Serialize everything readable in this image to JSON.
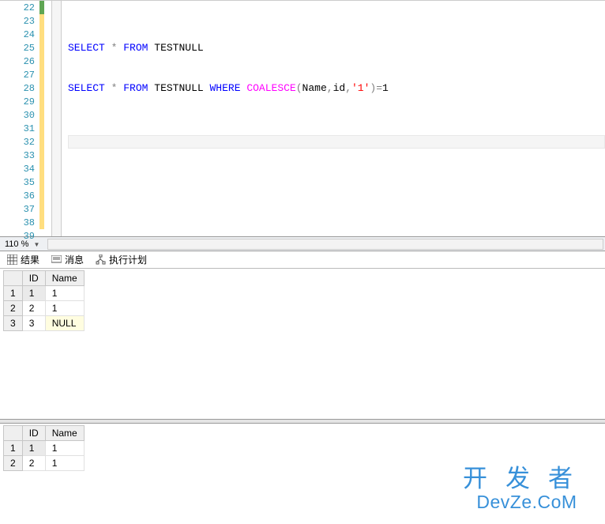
{
  "editor": {
    "line_start": 22,
    "line_end": 39,
    "marked_green": [
      22
    ],
    "marked_yellow": [
      23,
      24,
      25,
      26,
      27,
      28,
      29,
      30,
      31,
      32,
      33,
      34,
      35,
      36,
      37,
      38
    ],
    "cursor_line": 32,
    "lines": {
      "25": [
        {
          "t": "SELECT",
          "c": "kw"
        },
        {
          "t": " ",
          "c": "txt"
        },
        {
          "t": "*",
          "c": "star"
        },
        {
          "t": " ",
          "c": "txt"
        },
        {
          "t": "FROM",
          "c": "kw"
        },
        {
          "t": " TESTNULL",
          "c": "txt"
        }
      ],
      "28": [
        {
          "t": "SELECT",
          "c": "kw"
        },
        {
          "t": " ",
          "c": "txt"
        },
        {
          "t": "*",
          "c": "star"
        },
        {
          "t": " ",
          "c": "txt"
        },
        {
          "t": "FROM",
          "c": "kw"
        },
        {
          "t": " TESTNULL ",
          "c": "txt"
        },
        {
          "t": "WHERE",
          "c": "kw"
        },
        {
          "t": " ",
          "c": "txt"
        },
        {
          "t": "COALESCE",
          "c": "fn"
        },
        {
          "t": "(",
          "c": "op"
        },
        {
          "t": "Name",
          "c": "txt"
        },
        {
          "t": ",",
          "c": "op"
        },
        {
          "t": "id",
          "c": "txt"
        },
        {
          "t": ",",
          "c": "op"
        },
        {
          "t": "'1'",
          "c": "str"
        },
        {
          "t": ")=",
          "c": "op"
        },
        {
          "t": "1",
          "c": "txt"
        }
      ]
    }
  },
  "zoom": {
    "value": "110 %"
  },
  "tabs": {
    "results": "结果",
    "messages": "消息",
    "plan": "执行计划"
  },
  "grid1": {
    "columns": [
      "ID",
      "Name"
    ],
    "rows": [
      {
        "n": "1",
        "ID": "1",
        "Name": "1",
        "sel": true
      },
      {
        "n": "2",
        "ID": "2",
        "Name": "1"
      },
      {
        "n": "3",
        "ID": "3",
        "Name": "NULL",
        "null": true
      }
    ]
  },
  "grid2": {
    "columns": [
      "ID",
      "Name"
    ],
    "rows": [
      {
        "n": "1",
        "ID": "1",
        "Name": "1",
        "sel": true
      },
      {
        "n": "2",
        "ID": "2",
        "Name": "1"
      }
    ]
  },
  "watermark": {
    "cn": "开发者",
    "en": "DevZe.CoM"
  }
}
